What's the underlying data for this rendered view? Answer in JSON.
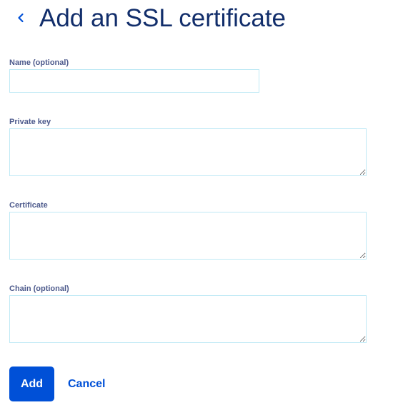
{
  "header": {
    "title": "Add an SSL certificate",
    "back_icon": "chevron-left-icon"
  },
  "form": {
    "name": {
      "label": "Name (optional)",
      "value": "",
      "placeholder": ""
    },
    "private_key": {
      "label": "Private key",
      "value": "",
      "placeholder": ""
    },
    "certificate": {
      "label": "Certificate",
      "value": "",
      "placeholder": ""
    },
    "chain": {
      "label": "Chain (optional)",
      "value": "",
      "placeholder": ""
    }
  },
  "actions": {
    "add_label": "Add",
    "cancel_label": "Cancel"
  },
  "colors": {
    "title": "#122e6b",
    "label": "#4d5a8c",
    "accent": "#0050d7",
    "input_border": "#bfe9f5"
  }
}
